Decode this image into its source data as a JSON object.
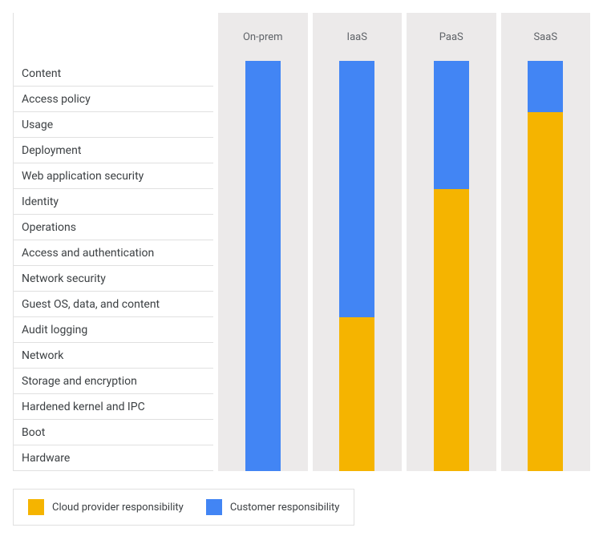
{
  "chart_data": {
    "type": "bar",
    "title": "",
    "layers": [
      "Content",
      "Access policy",
      "Usage",
      "Deployment",
      "Web application security",
      "Identity",
      "Operations",
      "Access and authentication",
      "Network security",
      "Guest OS, data, and content",
      "Audit logging",
      "Network",
      "Storage and encryption",
      "Hardened kernel and IPC",
      "Boot",
      "Hardware"
    ],
    "models": [
      {
        "name": "On-prem",
        "customer_layers": 16,
        "provider_layers": 0
      },
      {
        "name": "IaaS",
        "customer_layers": 10,
        "provider_layers": 6
      },
      {
        "name": "PaaS",
        "customer_layers": 5,
        "provider_layers": 11
      },
      {
        "name": "SaaS",
        "customer_layers": 2,
        "provider_layers": 14
      }
    ],
    "legend": {
      "provider": "Cloud provider responsibility",
      "customer": "Customer responsibility"
    },
    "colors": {
      "provider": "#f5b400",
      "customer": "#4285f4"
    },
    "ylim": [
      0,
      16
    ]
  }
}
